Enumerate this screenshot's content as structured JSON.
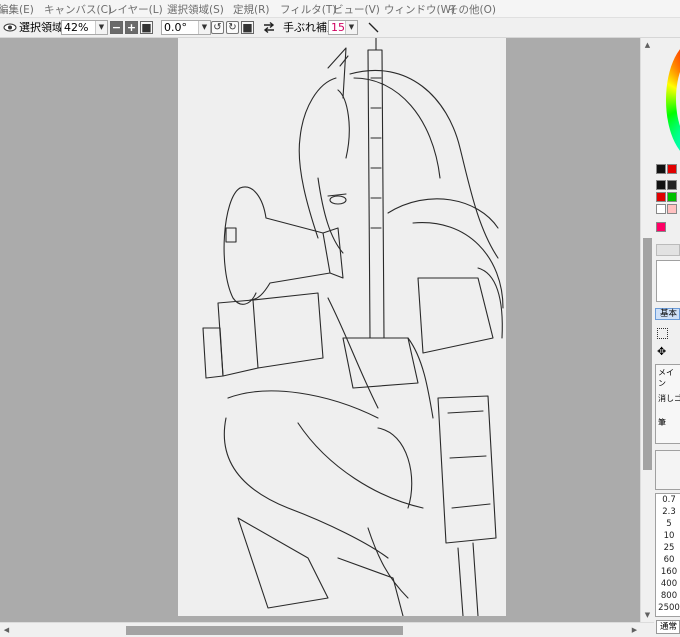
{
  "menu": {
    "items": [
      "編集(E)",
      "キャンバス(C)",
      "レイヤー(L)",
      "選択領域(S)",
      "定規(R)",
      "フィルタ(T)",
      "ビュー(V)",
      "ウィンドウ(W)",
      "その他(O)"
    ]
  },
  "toolbar": {
    "selection_label": "選択領域",
    "zoom_value": "42%",
    "rotation_value": "0.0°",
    "stabilizer_label": "手ぶれ補正",
    "stabilizer_value": "15"
  },
  "right_panel": {
    "tab_label": "基本",
    "main_label": "メイン",
    "eraser_label": "消しゴム",
    "pen_label": "筆",
    "brush_sizes": [
      "0.7",
      "2.3",
      "5",
      "10",
      "25",
      "60",
      "160",
      "400",
      "800",
      "2500"
    ],
    "blend_mode": "通常",
    "colors": {
      "swatch_row1": [
        "#111111",
        "#e00000"
      ],
      "swatch_row2": [
        "#111111",
        "#222222"
      ],
      "swatch_row3": [
        "#e00000",
        "#00c000"
      ],
      "swatch_row4": [
        "#ffffff",
        "#ffc0c0"
      ],
      "swatch_accent": "#ff0066"
    }
  },
  "icons": {
    "eye": "eye-icon",
    "flip": "flip-horizontal-icon",
    "pen": "pen-icon",
    "rotate_ccw": "rotate-left-icon",
    "rotate_cw": "rotate-right-icon",
    "reset": "reset-icon",
    "move": "move-icon",
    "select": "select-rect-icon"
  }
}
